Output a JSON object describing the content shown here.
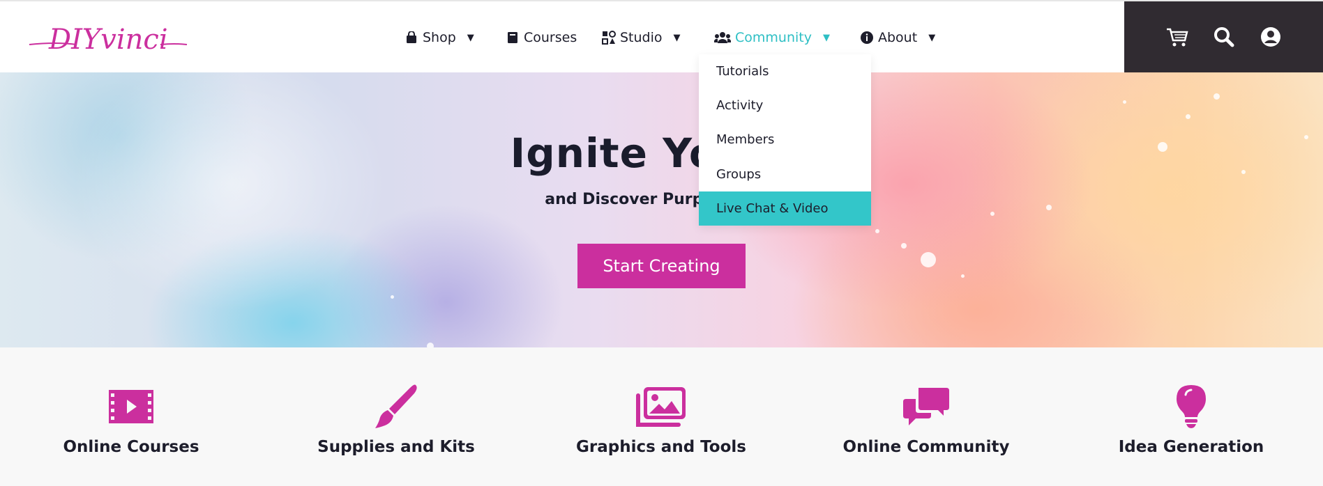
{
  "brand": {
    "logo_text": "DIYvinci",
    "accent": "#cb2f9e",
    "active_nav_color": "#2ebfc4"
  },
  "nav": {
    "items": [
      {
        "label": "Shop",
        "icon": "shopping-bag-icon",
        "has_dropdown": true
      },
      {
        "label": "Courses",
        "icon": "book-icon",
        "has_dropdown": false
      },
      {
        "label": "Studio",
        "icon": "palette-icon",
        "has_dropdown": true
      },
      {
        "label": "Community",
        "icon": "users-icon",
        "has_dropdown": true,
        "active": true
      },
      {
        "label": "About",
        "icon": "info-circle-icon",
        "has_dropdown": true
      }
    ]
  },
  "actions": [
    {
      "icon": "cart-icon"
    },
    {
      "icon": "search-icon"
    },
    {
      "icon": "user-account-icon"
    }
  ],
  "dropdown": {
    "items": [
      "Tutorials",
      "Activity",
      "Members",
      "Groups",
      "Live Chat & Video"
    ],
    "highlighted": "Live Chat & Video"
  },
  "hero": {
    "title_visible": "Ignite Your C",
    "subtitle_visible": "and Discover Purpose, Hea",
    "cta_label": "Start Creating"
  },
  "features": [
    {
      "label": "Online Courses",
      "icon": "video-film-icon"
    },
    {
      "label": "Supplies and Kits",
      "icon": "paintbrush-icon"
    },
    {
      "label": "Graphics and Tools",
      "icon": "images-icon"
    },
    {
      "label": "Online Community",
      "icon": "chat-bubbles-icon"
    },
    {
      "label": "Idea Generation",
      "icon": "lightbulb-icon"
    }
  ]
}
